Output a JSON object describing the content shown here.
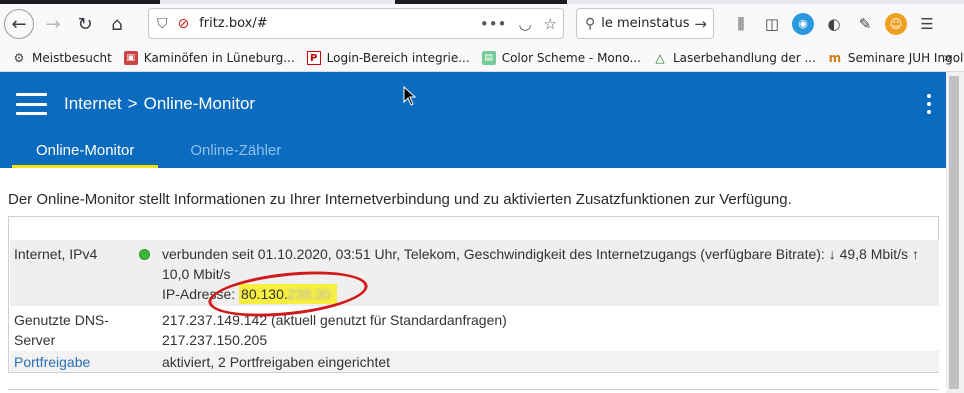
{
  "browser": {
    "url": "fritz.box/#",
    "search_value": "le meinstatus",
    "bookmarks": [
      {
        "label": "Meistbesucht",
        "icon": "gear-icon"
      },
      {
        "label": "Kaminöfen in Lüneburg...",
        "icon": "k-icon"
      },
      {
        "label": "Login-Bereich integrie...",
        "icon": "p-icon"
      },
      {
        "label": "Color Scheme - Mono...",
        "icon": "c-icon"
      },
      {
        "label": "Laserbehandlung der ...",
        "icon": "l-icon"
      },
      {
        "label": "Seminare JUH Ingolsta...",
        "icon": "m-icon"
      }
    ]
  },
  "header": {
    "crumb_root": "Internet",
    "crumb_sep": ">",
    "crumb_page": "Online-Monitor",
    "tabs": [
      {
        "label": "Online-Monitor",
        "active": true
      },
      {
        "label": "Online-Zähler",
        "active": false
      }
    ]
  },
  "main": {
    "intro": "Der Online-Monitor stellt Informationen zu Ihrer Internetverbindung und zu aktivierten Zusatzfunktionen zur Verfügung.",
    "rows": [
      {
        "label": "Internet, IPv4",
        "status_color": "#3cb73c",
        "line1": "verbunden seit 01.10.2020, 03:51 Uhr, Telekom, Geschwindigkeit des Internetzugangs (verfügbare Bitrate): ↓ 49,8 Mbit/s ↑",
        "line2": "10,0 Mbit/s",
        "ip_label": "IP-Adresse:",
        "ip_prefix": "80.130.",
        "ip_hidden": "238.30"
      },
      {
        "label": "Genutzte DNS-Server",
        "line1": "217.237.149.142 (aktuell genutzt für Standardanfragen)",
        "line2": "217.237.150.205"
      },
      {
        "label": "Portfreigabe",
        "line1": "aktiviert, 2 Portfreigaben eingerichtet"
      }
    ]
  },
  "colors": {
    "header_bg": "#0a6bbf",
    "tab_underline": "#f4e400",
    "annotation": "#d11a1a",
    "highlight": "#f6ee40"
  }
}
